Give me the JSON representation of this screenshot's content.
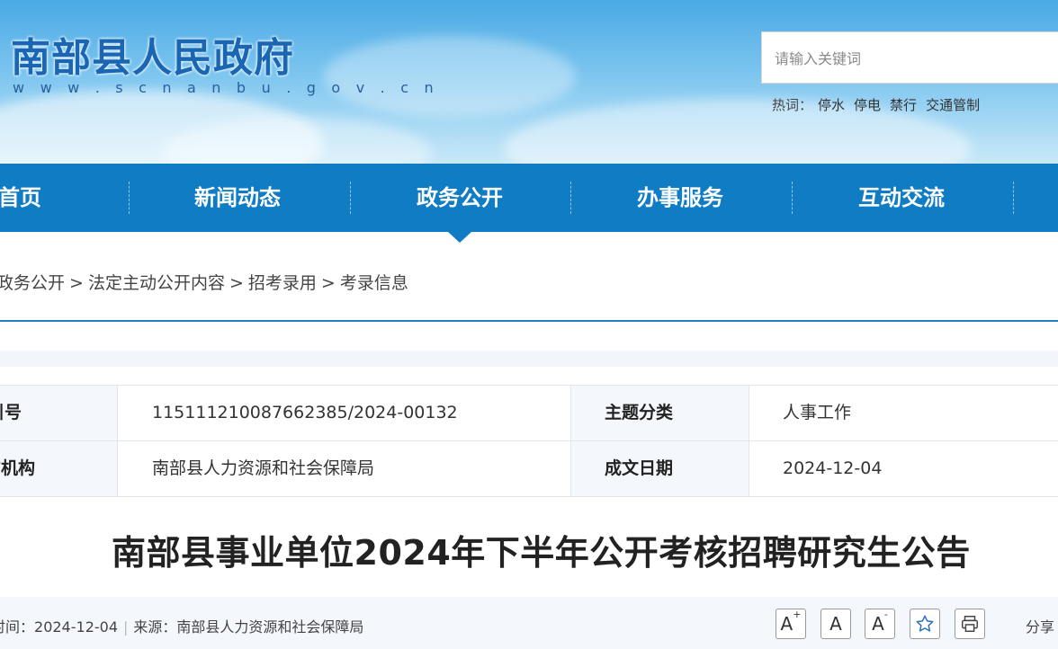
{
  "header": {
    "site_title": "南部县人民政府",
    "site_url": "w w w . s c n a n b u . g o v . c n",
    "search_placeholder": "请输入关键词",
    "hot_label": "热词：",
    "hot_words": [
      "停水",
      "停电",
      "禁行",
      "交通管制"
    ]
  },
  "nav": {
    "items": [
      "首页",
      "新闻动态",
      "政务公开",
      "办事服务",
      "互动交流"
    ],
    "active": "政务公开"
  },
  "breadcrumb": {
    "items": [
      "政务公开",
      "法定主动公开内容",
      "招考录用",
      "考录信息"
    ],
    "separator": ">"
  },
  "info": {
    "rows": [
      {
        "label1": "引号",
        "value1": "11511121008766238​5/2024-00132",
        "label2": "主题分类",
        "value2": "人事工作"
      },
      {
        "label1": "布机构",
        "value1": "南部县人力资源和社会保障局",
        "label2": "成文日期",
        "value2": "2024-12-04"
      }
    ]
  },
  "article": {
    "title": "南部县事业单位2024年下半年公开考核招聘研究生公告",
    "time_label": "时间：",
    "time_value": "2024-12-04",
    "source_label": "来源：",
    "source_value": "南部县人力资源和社会保障局",
    "share_label": "分享"
  },
  "tools": {
    "font_increase": "A",
    "font_reset": "A",
    "font_decrease": "A",
    "favorite_icon": "star-icon",
    "print_icon": "printer-icon"
  },
  "colors": {
    "nav_bg": "#0f7cc4",
    "title_blue": "#1a66b3",
    "line_blue": "#1f7fbf"
  }
}
